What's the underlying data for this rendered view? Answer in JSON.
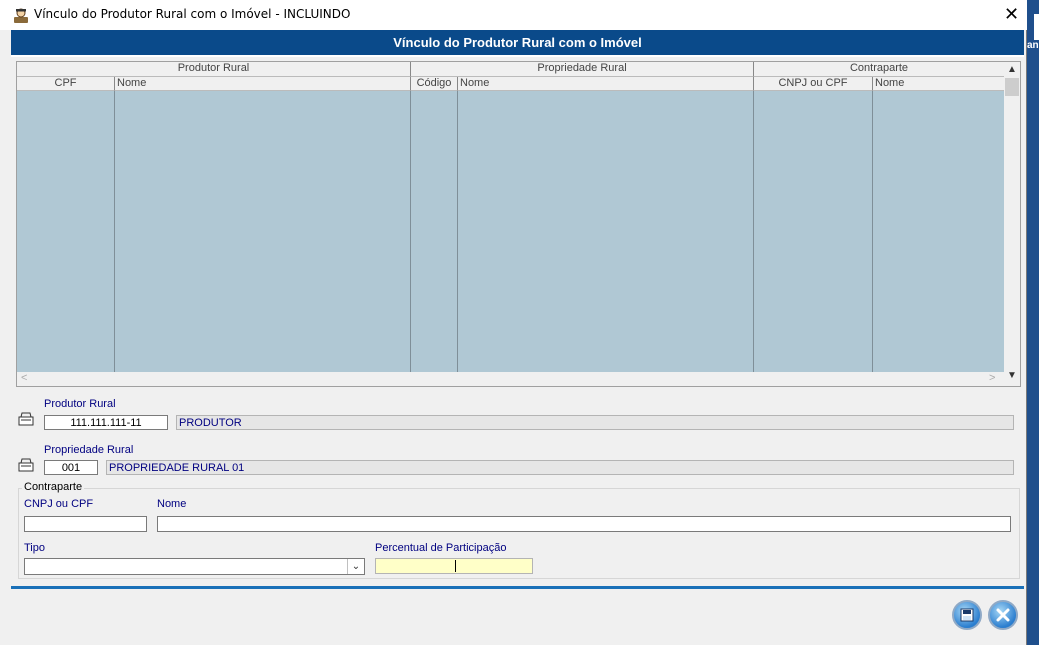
{
  "window": {
    "title": "Vínculo do Produtor Rural com o Imóvel   -   INCLUINDO",
    "close_glyph": "✕",
    "background_app_text": "an"
  },
  "header": {
    "title": "Vínculo do Produtor Rural com o Imóvel"
  },
  "grid": {
    "groups": [
      "Produtor Rural",
      "Propriedade Rural",
      "Contraparte"
    ],
    "columns": [
      "CPF",
      "Nome",
      "Código",
      "Nome",
      "CNPJ ou CPF",
      "Nome"
    ],
    "rows": []
  },
  "form": {
    "produtor_label": "Produtor Rural",
    "produtor_cpf": "111.111.111-11",
    "produtor_nome": "PRODUTOR",
    "propriedade_label": "Propriedade Rural",
    "propriedade_codigo": "001",
    "propriedade_nome": "PROPRIEDADE RURAL 01",
    "contraparte_group": "Contraparte",
    "cnpj_label": "CNPJ ou CPF",
    "cnpj_value": "",
    "nome_label": "Nome",
    "nome_value": "",
    "tipo_label": "Tipo",
    "tipo_value": "",
    "percentual_label": "Percentual de Participação",
    "percentual_value": ""
  },
  "icons": {
    "app": "user-icon",
    "lookup": "lookup-icon",
    "save": "save-icon",
    "cancel": "cancel-icon"
  },
  "colors": {
    "header_bg": "#0a4a8a",
    "grid_bg": "#b0c8d4",
    "label": "#000080",
    "percent_bg": "#ffffc8"
  }
}
